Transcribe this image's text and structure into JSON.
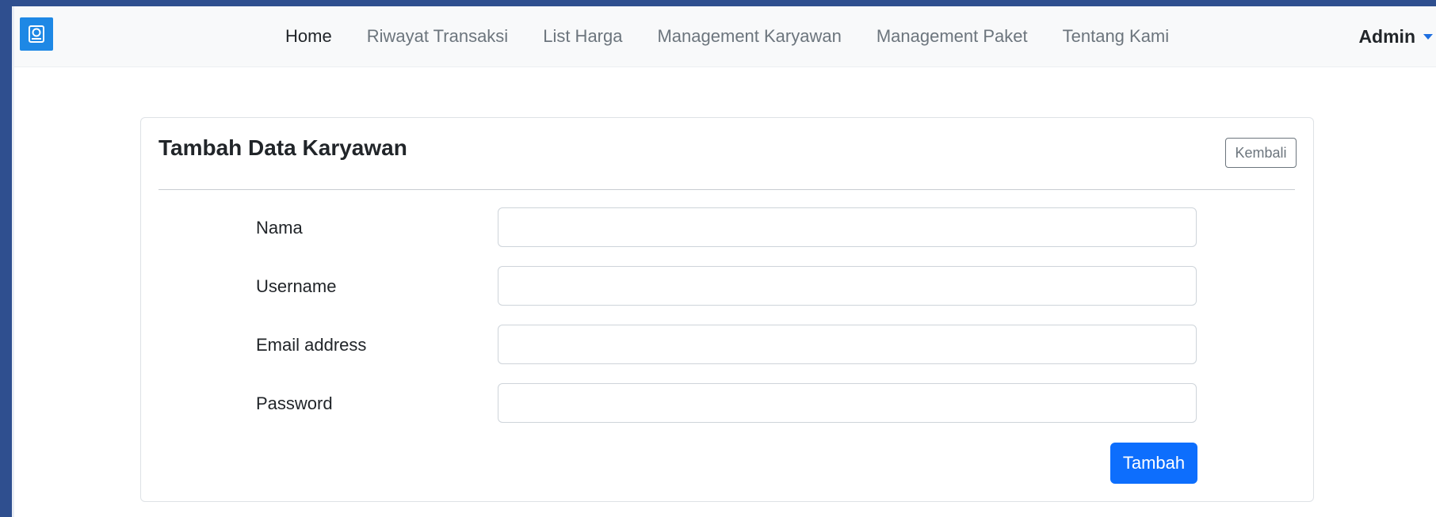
{
  "navbar": {
    "brand_icon": "laundry-machine-icon",
    "links": [
      {
        "label": "Home",
        "active": true
      },
      {
        "label": "Riwayat Transaksi",
        "active": false
      },
      {
        "label": "List Harga",
        "active": false
      },
      {
        "label": "Management Karyawan",
        "active": false
      },
      {
        "label": "Management Paket",
        "active": false
      },
      {
        "label": "Tentang Kami",
        "active": false
      }
    ],
    "user": "Admin"
  },
  "card": {
    "title": "Tambah Data Karyawan",
    "back_label": "Kembali",
    "fields": [
      {
        "label": "Nama",
        "value": "",
        "placeholder": ""
      },
      {
        "label": "Username",
        "value": "",
        "placeholder": ""
      },
      {
        "label": "Email address",
        "value": "",
        "placeholder": ""
      },
      {
        "label": "Password",
        "value": "",
        "placeholder": ""
      }
    ],
    "submit_label": "Tambah"
  },
  "colors": {
    "frame": "#2f4f8f",
    "brand": "#1e88e5",
    "primary": "#0d6efd",
    "navbar_bg": "#f8f9fa"
  }
}
